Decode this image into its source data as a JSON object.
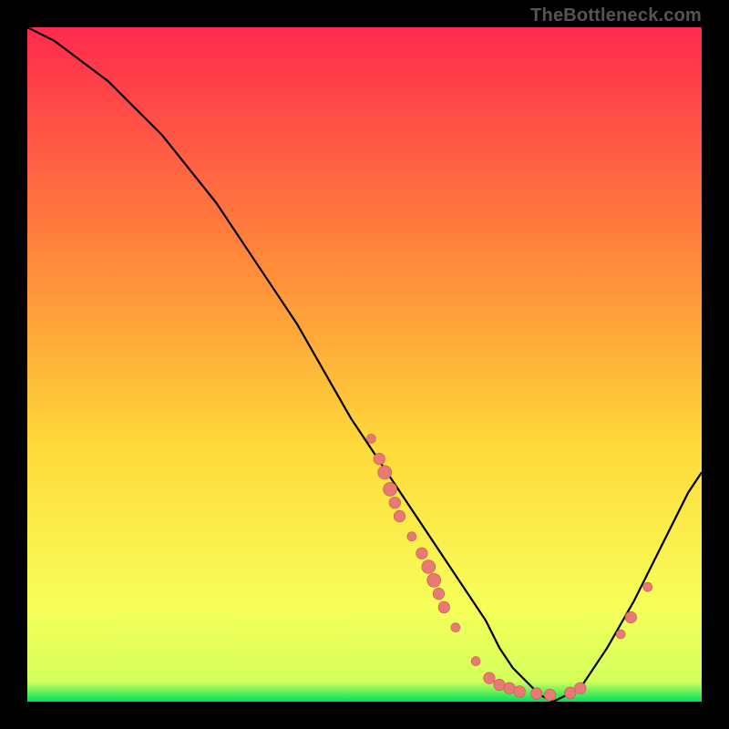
{
  "watermark": "TheBottleneck.com",
  "colors": {
    "bg_black": "#000000",
    "grad_top": "#ff2a4d",
    "grad_mid1": "#ff6f3a",
    "grad_mid2": "#ffd93a",
    "grad_mid3": "#f7ff5a",
    "grad_bottom": "#00e05a",
    "curve": "#000000",
    "dot_fill": "#e77a74",
    "dot_stroke": "#c9554f"
  },
  "chart_data": {
    "type": "line",
    "title": "",
    "xlabel": "",
    "ylabel": "",
    "xlim": [
      0,
      100
    ],
    "ylim": [
      0,
      100
    ],
    "series": [
      {
        "name": "bottleneck-curve",
        "x": [
          0,
          4,
          8,
          12,
          16,
          20,
          24,
          28,
          32,
          36,
          40,
          44,
          48,
          52,
          56,
          60,
          64,
          68,
          70,
          72,
          74,
          76,
          78,
          82,
          86,
          90,
          94,
          98,
          100
        ],
        "y": [
          100,
          98,
          95,
          92,
          88,
          84,
          79,
          74,
          68,
          62,
          56,
          49,
          42,
          36,
          30,
          24,
          18,
          12,
          8,
          5,
          3,
          1,
          0,
          2,
          8,
          15,
          23,
          31,
          34
        ]
      }
    ],
    "scatter": [
      {
        "name": "cluster-dots",
        "points": [
          {
            "x": 51.0,
            "y": 39.0,
            "r": 4
          },
          {
            "x": 52.2,
            "y": 36.0,
            "r": 5
          },
          {
            "x": 53.0,
            "y": 34.0,
            "r": 6
          },
          {
            "x": 53.8,
            "y": 31.5,
            "r": 6
          },
          {
            "x": 54.5,
            "y": 29.5,
            "r": 5
          },
          {
            "x": 55.2,
            "y": 27.5,
            "r": 5
          },
          {
            "x": 57.0,
            "y": 24.5,
            "r": 4
          },
          {
            "x": 58.5,
            "y": 22.0,
            "r": 5
          },
          {
            "x": 59.5,
            "y": 20.0,
            "r": 6
          },
          {
            "x": 60.3,
            "y": 18.0,
            "r": 6
          },
          {
            "x": 61.0,
            "y": 16.0,
            "r": 5
          },
          {
            "x": 61.8,
            "y": 14.0,
            "r": 5
          },
          {
            "x": 63.5,
            "y": 11.0,
            "r": 4
          },
          {
            "x": 66.5,
            "y": 6.0,
            "r": 4
          },
          {
            "x": 68.5,
            "y": 3.5,
            "r": 5
          },
          {
            "x": 70.0,
            "y": 2.5,
            "r": 5
          },
          {
            "x": 71.5,
            "y": 2.0,
            "r": 5
          },
          {
            "x": 73.0,
            "y": 1.5,
            "r": 5
          },
          {
            "x": 75.5,
            "y": 1.2,
            "r": 5
          },
          {
            "x": 77.5,
            "y": 1.0,
            "r": 5
          },
          {
            "x": 80.5,
            "y": 1.3,
            "r": 5
          },
          {
            "x": 82.0,
            "y": 2.0,
            "r": 5
          },
          {
            "x": 88.0,
            "y": 10.0,
            "r": 4
          },
          {
            "x": 89.5,
            "y": 12.5,
            "r": 5
          },
          {
            "x": 92.0,
            "y": 17.0,
            "r": 4
          }
        ]
      }
    ]
  }
}
